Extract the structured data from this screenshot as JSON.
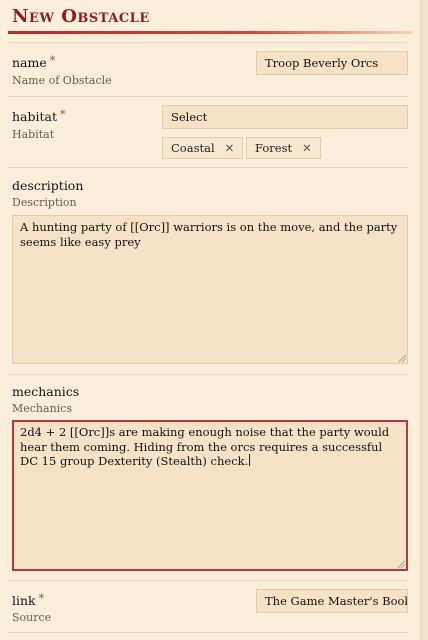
{
  "title": "New Obstacle",
  "fields": {
    "name": {
      "label": "name",
      "required": "*",
      "sublabel": "Name of Obstacle",
      "value": "Troop Beverly Orcs"
    },
    "habitat": {
      "label": "habitat",
      "required": "*",
      "sublabel": "Habitat",
      "placeholder": "Select",
      "chips": [
        {
          "label": "Coastal",
          "remove": "✕"
        },
        {
          "label": "Forest",
          "remove": "✕"
        }
      ]
    },
    "description": {
      "label": "description",
      "sublabel": "Description",
      "value": "A hunting party of [[Orc]] warriors is on the move, and the party seems like easy prey"
    },
    "mechanics": {
      "label": "mechanics",
      "sublabel": "Mechanics",
      "value": "2d4 + 2 [[Orc]]s are making enough noise that the party would hear them coming. Hiding from the orcs requires a successful DC 15 group Dexterity (Stealth) check."
    },
    "link": {
      "label": "link",
      "required": "*",
      "sublabel": "Source",
      "value": "The Game Master's Book of Random Encounters"
    }
  },
  "colors": {
    "accent": "#8f1d1d",
    "field_bg": "#f6e2c6",
    "page_bg": "#fbefdc",
    "active_border": "#b23a3a"
  }
}
